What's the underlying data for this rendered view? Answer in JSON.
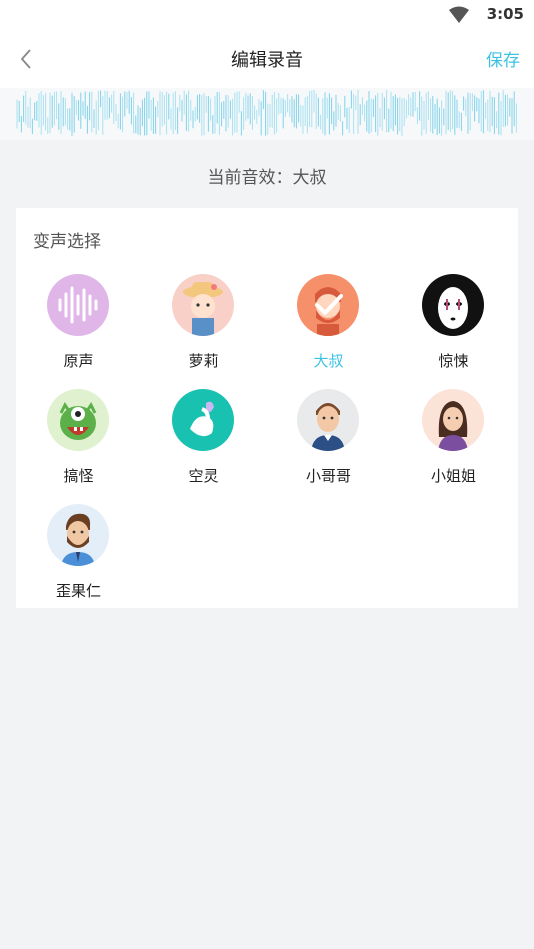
{
  "status": {
    "time": "3:05"
  },
  "nav": {
    "title": "编辑录音",
    "save": "保存"
  },
  "current_effect": "当前音效：大叔",
  "card": {
    "title": "变声选择",
    "items": [
      {
        "label": "原声",
        "icon": "original-voice-icon",
        "selected": false
      },
      {
        "label": "萝莉",
        "icon": "loli-icon",
        "selected": false
      },
      {
        "label": "大叔",
        "icon": "uncle-icon",
        "selected": true
      },
      {
        "label": "惊悚",
        "icon": "thriller-icon",
        "selected": false
      },
      {
        "label": "搞怪",
        "icon": "monster-icon",
        "selected": false
      },
      {
        "label": "空灵",
        "icon": "ethereal-icon",
        "selected": false
      },
      {
        "label": "小哥哥",
        "icon": "young-man-icon",
        "selected": false
      },
      {
        "label": "小姐姐",
        "icon": "young-woman-icon",
        "selected": false
      },
      {
        "label": "歪果仁",
        "icon": "foreigner-icon",
        "selected": false
      }
    ]
  },
  "colors": {
    "accent": "#3cc3e3",
    "background": "#f2f3f5"
  }
}
